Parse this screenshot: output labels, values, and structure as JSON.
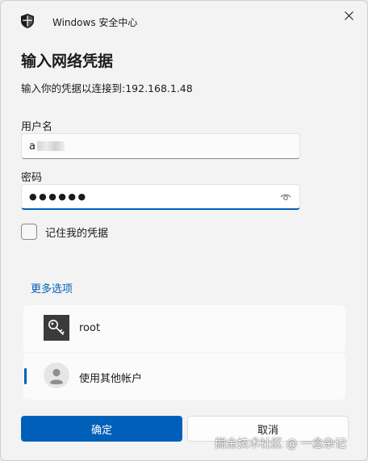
{
  "window": {
    "app_title": "Windows 安全中心"
  },
  "dialog": {
    "heading": "输入网络凭据",
    "subtitle": "输入你的凭据以连接到:192.168.1.48",
    "username": {
      "label": "用户名",
      "value": "a"
    },
    "password": {
      "label": "密码",
      "value": "●●●●●●"
    },
    "remember": {
      "label": "记住我的凭据",
      "checked": false
    },
    "more_options": "更多选项",
    "accounts": [
      {
        "name": "root",
        "icon": "key-icon"
      },
      {
        "name": "使用其他帐户",
        "icon": "person-icon",
        "selected": true
      }
    ],
    "ok_label": "确定",
    "cancel_label": "取消"
  },
  "watermark": "掘金技术社区 @ 一念杂记",
  "colors": {
    "accent": "#005fb8",
    "background": "#f3f3f3"
  }
}
